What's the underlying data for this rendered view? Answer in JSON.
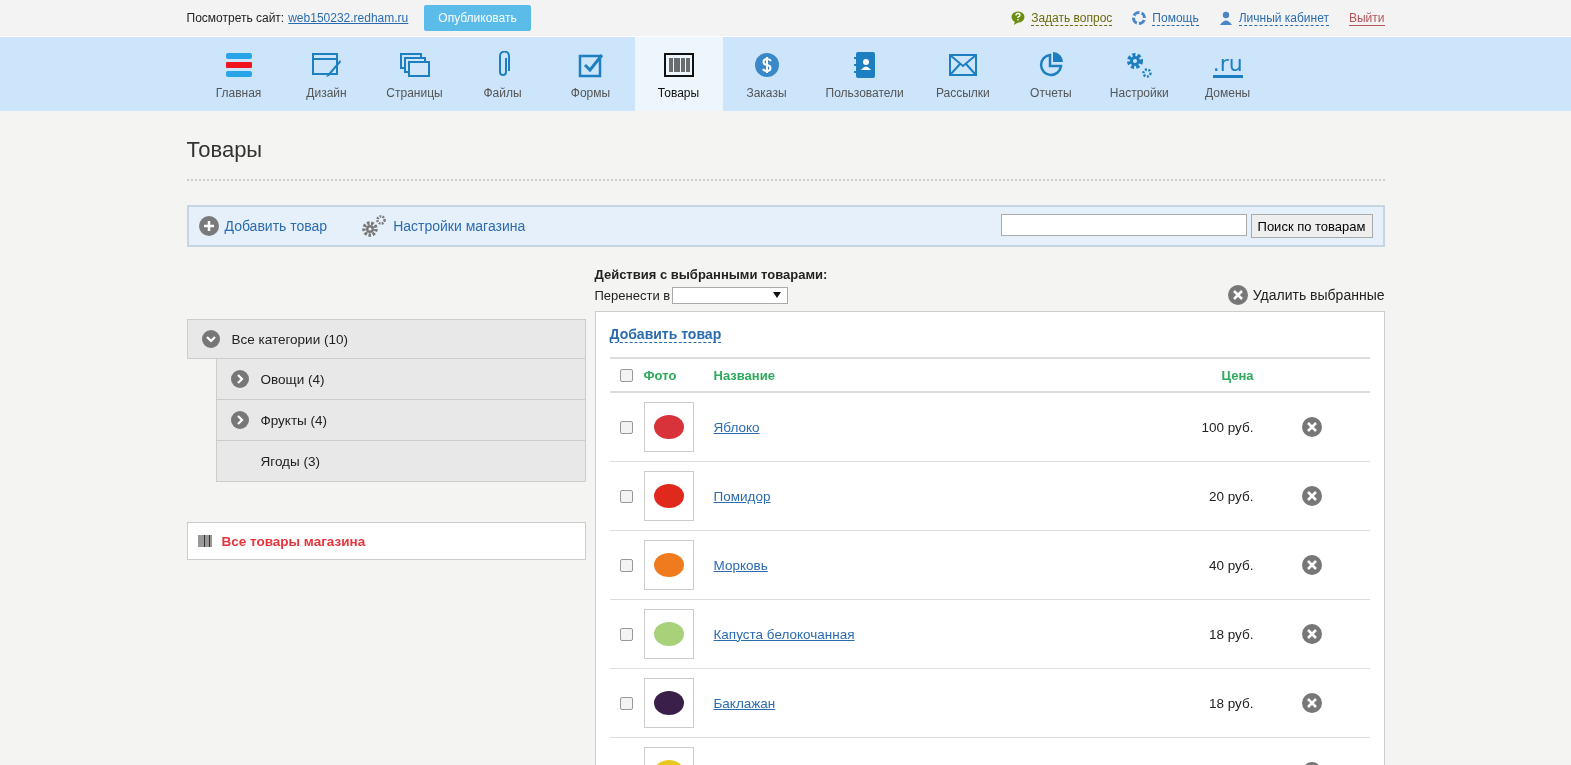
{
  "top_bar": {
    "site_label": "Посмотреть сайт:",
    "site_link": "web150232.redham.ru",
    "publish_button": "Опубликовать",
    "links": [
      {
        "kind": "question",
        "label": "Задать вопрос"
      },
      {
        "kind": "help",
        "label": "Помощь"
      },
      {
        "kind": "user",
        "label": "Личный кабинет"
      },
      {
        "kind": "logout",
        "label": "Выйти"
      }
    ]
  },
  "nav": [
    {
      "kind": "home",
      "label": "Главная",
      "selected": false
    },
    {
      "kind": "design",
      "label": "Дизайн",
      "selected": false
    },
    {
      "kind": "pages",
      "label": "Страницы",
      "selected": false
    },
    {
      "kind": "files",
      "label": "Файлы",
      "selected": false
    },
    {
      "kind": "forms",
      "label": "Формы",
      "selected": false
    },
    {
      "kind": "goods",
      "label": "Товары",
      "selected": true
    },
    {
      "kind": "orders",
      "label": "Заказы",
      "selected": false
    },
    {
      "kind": "users",
      "label": "Пользователи",
      "selected": false
    },
    {
      "kind": "mail",
      "label": "Рассылки",
      "selected": false
    },
    {
      "kind": "reports",
      "label": "Отчеты",
      "selected": false
    },
    {
      "kind": "settings",
      "label": "Настройки",
      "selected": false
    },
    {
      "kind": "domains",
      "label": "Домены",
      "selected": false,
      "glyph": ".ru"
    }
  ],
  "page_title": "Товары",
  "toolbar": {
    "add_product": "Добавить товар",
    "shop_settings": "Настройки магазина",
    "search_button": "Поиск по товарам"
  },
  "categories": [
    {
      "label": "Все категории (10)",
      "kind": "branch",
      "expanded": true,
      "children": [
        {
          "label": "Овощи (4)",
          "kind": "branch",
          "expanded": false
        },
        {
          "label": "Фрукты (4)",
          "kind": "branch",
          "expanded": false
        },
        {
          "label": "Ягоды (3)",
          "kind": "leaf"
        }
      ]
    }
  ],
  "all_products_link": "Все товары магазина",
  "bulk_actions": {
    "title": "Действия с выбранными товарами:",
    "move_label": "Перенести в",
    "delete_selected": "Удалить выбранные"
  },
  "products_panel": {
    "add_product": "Добавить товар",
    "select_all_checked": false,
    "columns": [
      "Фото",
      "Название",
      "Цена"
    ],
    "rows": [
      {
        "name": "Яблоко",
        "price": "100 руб.",
        "checked": false
      },
      {
        "name": "Помидор",
        "price": "20 руб.",
        "checked": false
      },
      {
        "name": "Морковь",
        "price": "40 руб.",
        "checked": false
      },
      {
        "name": "Капуста белокочанная",
        "price": "18 руб.",
        "checked": false
      },
      {
        "name": "Баклажан",
        "price": "18 руб.",
        "checked": false
      },
      {}
    ]
  }
}
